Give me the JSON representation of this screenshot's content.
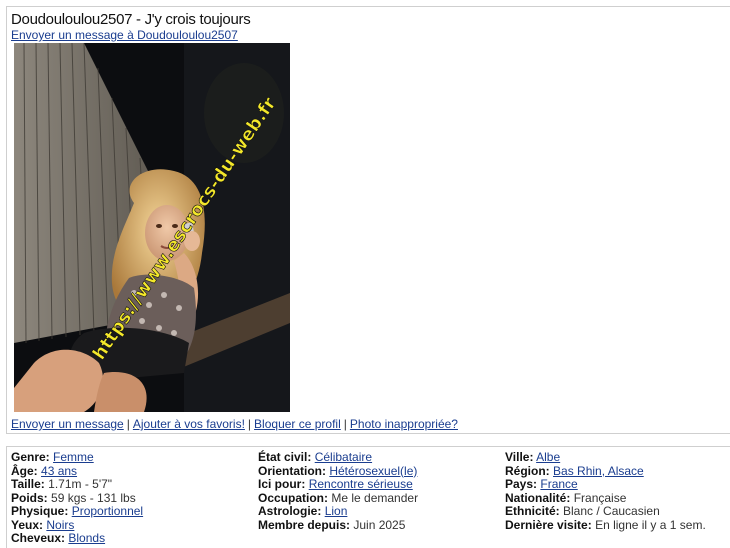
{
  "header": {
    "title": "Doudouloulou2507 - J'y crois toujours",
    "send_message_link": "Envoyer un message à Doudouloulou2507"
  },
  "photo": {
    "watermark": "https://www.escrocs-du-web.fr"
  },
  "actions": {
    "send": "Envoyer un message",
    "favorite": "Ajouter à vos favoris!",
    "block": "Bloquer ce profil",
    "report": "Photo inappropriée?",
    "separator": "|"
  },
  "details": {
    "col1": [
      {
        "label": "Genre:",
        "value": "Femme",
        "link": true
      },
      {
        "label": "Âge:",
        "value": "43 ans",
        "link": true
      },
      {
        "label": "Taille:",
        "value": "1.71m - 5'7\"",
        "link": false
      },
      {
        "label": "Poids:",
        "value": "59 kgs - 131 lbs",
        "link": false
      },
      {
        "label": "Physique:",
        "value": "Proportionnel",
        "link": true
      },
      {
        "label": "Yeux:",
        "value": "Noirs",
        "link": true
      },
      {
        "label": "Cheveux:",
        "value": "Blonds",
        "link": true
      }
    ],
    "col2": [
      {
        "label": "État civil:",
        "value": "Célibataire",
        "link": true
      },
      {
        "label": "Orientation:",
        "value": "Hétérosexuel(le)",
        "link": true
      },
      {
        "label": "Ici pour:",
        "value": "Rencontre sérieuse",
        "link": true
      },
      {
        "label": "Occupation:",
        "value": "Me le demander",
        "link": false
      },
      {
        "label": "Astrologie:",
        "value": "Lion",
        "link": true
      },
      {
        "label": "Membre depuis:",
        "value": "Juin 2025",
        "link": false
      }
    ],
    "col3": [
      {
        "label": "Ville:",
        "value": "Albe",
        "link": true
      },
      {
        "label": "Région:",
        "value": "Bas Rhin, Alsace",
        "link": true
      },
      {
        "label": "Pays:",
        "value": "France",
        "link": true
      },
      {
        "label": "Nationalité:",
        "value": "Française",
        "link": false
      },
      {
        "label": "Ethnicité:",
        "value": "Blanc / Caucasien",
        "link": false
      },
      {
        "label": "Dernière visite:",
        "value": "En ligne il y a 1 sem.",
        "link": false
      }
    ]
  }
}
